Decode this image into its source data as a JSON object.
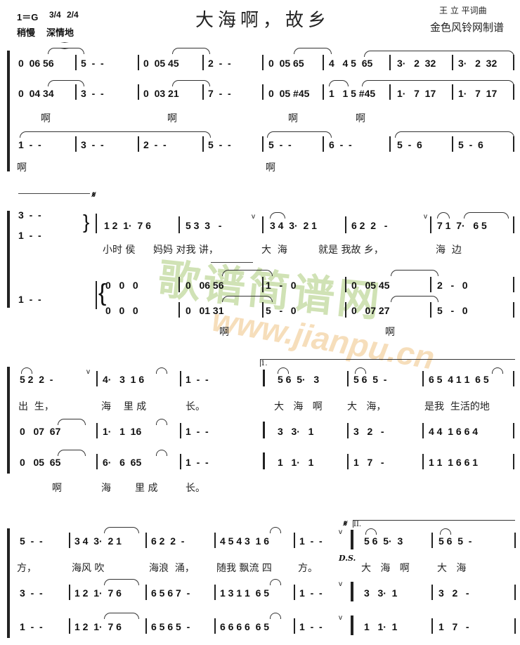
{
  "header": {
    "key": "1＝G",
    "time_sig_1": "3/4",
    "time_sig_2": "2/4",
    "tempo": "稍慢",
    "expression": "深情地",
    "title": "大海啊，故乡",
    "composer": "王  立  平词曲",
    "transcriber": "金色风铃网制谱"
  },
  "watermark": {
    "text_cn": "歌谱简谱网",
    "text_url": "www.jianpu.cn"
  },
  "system1": {
    "voice1": [
      "0  06 56",
      "5  -  -",
      "0  05 45",
      "2  -  -",
      "0  05 65",
      "4   4 5  65",
      "3·   2  32",
      "3·   2  32"
    ],
    "voice2": [
      "0  04 34",
      "3  -  -",
      "0  03 21",
      "7  -  -",
      "0  05 #45",
      "1   1 5 #45",
      "1·   7  17",
      "1·   7  17"
    ],
    "lyrics2": [
      "啊",
      "啊",
      "啊",
      "啊"
    ],
    "voice3": [
      "1  -  -",
      "3  -  -",
      "2  -  -",
      "5  -  -",
      "5  -  -",
      "6  -  -",
      "5  -  6",
      "5  -  6"
    ],
    "lyrics3": [
      "啊",
      "啊"
    ]
  },
  "system2": {
    "upper_pickup_top": "3  -  -",
    "upper_pickup_bottom": "1  -  -",
    "melody": [
      "1 2  1·  7 6",
      "5 3  3   -",
      "3 4  3·  2 1",
      "6 2  2   -",
      "7 1  7·   6 5"
    ],
    "lyrics": [
      "小时 侯",
      "妈妈 对我 讲，",
      "大  海",
      "就是 我故 乡，",
      "海  边"
    ],
    "lower_pickup": "1  -  -",
    "choir_top": [
      "0   0   0",
      "0   06 56",
      "1   -   0",
      "0   05 45",
      "2   -   0"
    ],
    "choir_bottom": [
      "0   0   0",
      "0   01 31",
      "5   -   0",
      "0   07 27",
      "5   -   0"
    ],
    "choir_lyrics": [
      "啊",
      "啊"
    ]
  },
  "system3": {
    "melody": [
      "5 2  2  -",
      "4·   3  1 6",
      "1  -  -",
      "5 6  5·   3",
      "5 6  5  -",
      "6 5  4 1 1  6 5"
    ],
    "lyrics": [
      "出  生，",
      "海    里 成",
      "长。",
      "大   海   啊",
      "大   海，",
      "是我  生活的地"
    ],
    "voice2": [
      "0   07  67",
      "1·   1  16",
      "1  -  -",
      "3   3·   1",
      "3   2   -",
      "4 4  1 6 6 4"
    ],
    "voice3": [
      "0   05  65",
      "6·   6  65",
      "1  -  -",
      "1   1·   1",
      "1   7   -",
      "1 1  1 6 6 1"
    ],
    "lyrics3": [
      "啊",
      "海",
      "里 成",
      "长。"
    ],
    "volta": "1."
  },
  "system4": {
    "melody": [
      "5  -  -",
      "3 4  3·  2 1",
      "6 2  2  -",
      "4 5 4 3  1 6",
      "1  -  -",
      "5 6  5·  3",
      "5 6  5  -"
    ],
    "lyrics": [
      "方，",
      "海风 吹",
      "海浪  涌，",
      "随我 飘流 四",
      "方。",
      "大   海   啊",
      "大   海"
    ],
    "voice2": [
      "3  -  -",
      "1 2  1·  7 6",
      "6 5 6 7  -",
      "1 3 1 1  6 5",
      "1  -  -",
      "3   3·  1",
      "3   2   -"
    ],
    "voice3": [
      "1  -  -",
      "1 2  1·  7 6",
      "6 5 6 5  -",
      "6 6 6 6  6 5",
      "1  -  -",
      "1   1·  1",
      "1   7   -"
    ],
    "ds_label": "D.S.",
    "segno": "𝄋",
    "volta": "II."
  }
}
